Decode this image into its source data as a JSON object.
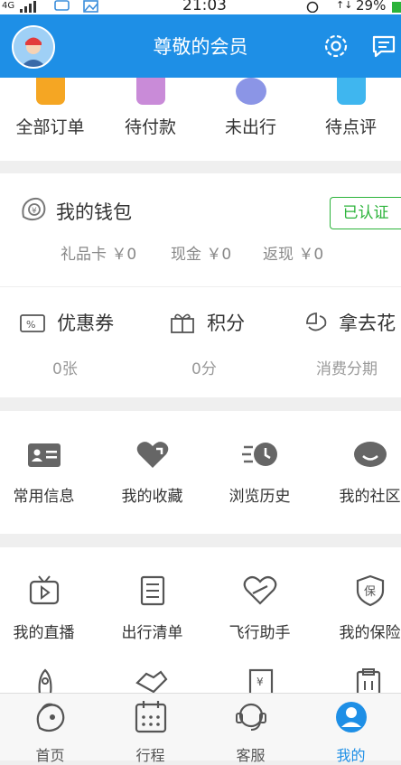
{
  "status": {
    "network": "4G",
    "time": "21:03",
    "battery": "29%"
  },
  "header": {
    "title": "尊敬的会员",
    "settings_icon": "gear-icon",
    "message_icon": "message-icon"
  },
  "orders": [
    {
      "label": "全部订单",
      "color": "#f5a623"
    },
    {
      "label": "待付款",
      "color": "#c98bd8"
    },
    {
      "label": "未出行",
      "color": "#8b95e6"
    },
    {
      "label": "待点评",
      "color": "#3fb6ef"
    }
  ],
  "wallet": {
    "title": "我的钱包",
    "verified": "已认证",
    "items": [
      "礼品卡 ￥0",
      "现金 ￥0",
      "返现 ￥0"
    ]
  },
  "perks": [
    {
      "name": "优惠券",
      "value": "0张"
    },
    {
      "name": "积分",
      "value": "0分"
    },
    {
      "name": "拿去花",
      "value": "消费分期"
    }
  ],
  "grid1": [
    "常用信息",
    "我的收藏",
    "浏览历史",
    "我的社区"
  ],
  "grid2": [
    "我的直播",
    "出行清单",
    "飞行助手",
    "我的保险"
  ],
  "tabs": [
    {
      "label": "首页"
    },
    {
      "label": "行程"
    },
    {
      "label": "客服"
    },
    {
      "label": "我的"
    }
  ],
  "colors": {
    "brand": "#1e8fe6",
    "verified": "#2bb33a"
  }
}
